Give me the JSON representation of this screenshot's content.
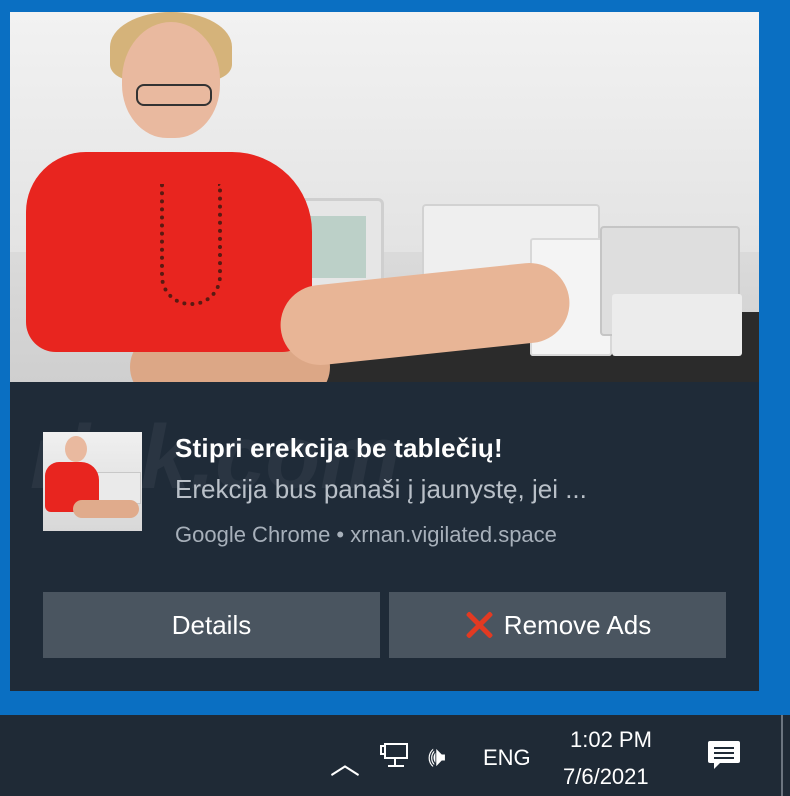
{
  "notification": {
    "title": "Stipri erekcija be tablečių!",
    "body": "Erekcija bus panaši į jaunystę, jei ...",
    "source": "Google Chrome • xrnan.vigilated.space",
    "buttons": {
      "details_label": "Details",
      "remove_ads_label": "Remove Ads"
    }
  },
  "watermark": "risk.com",
  "taskbar": {
    "language": "ENG",
    "time": "1:02 PM",
    "date": "7/6/2021",
    "icons": [
      "chevron-up-icon",
      "network-icon",
      "volume-icon",
      "action-center-icon"
    ]
  },
  "colors": {
    "toast_bg": "#1f2b38",
    "button_bg": "#4a5560",
    "accent_desktop": "#0a6fc2",
    "close_x": "#e23a22"
  }
}
